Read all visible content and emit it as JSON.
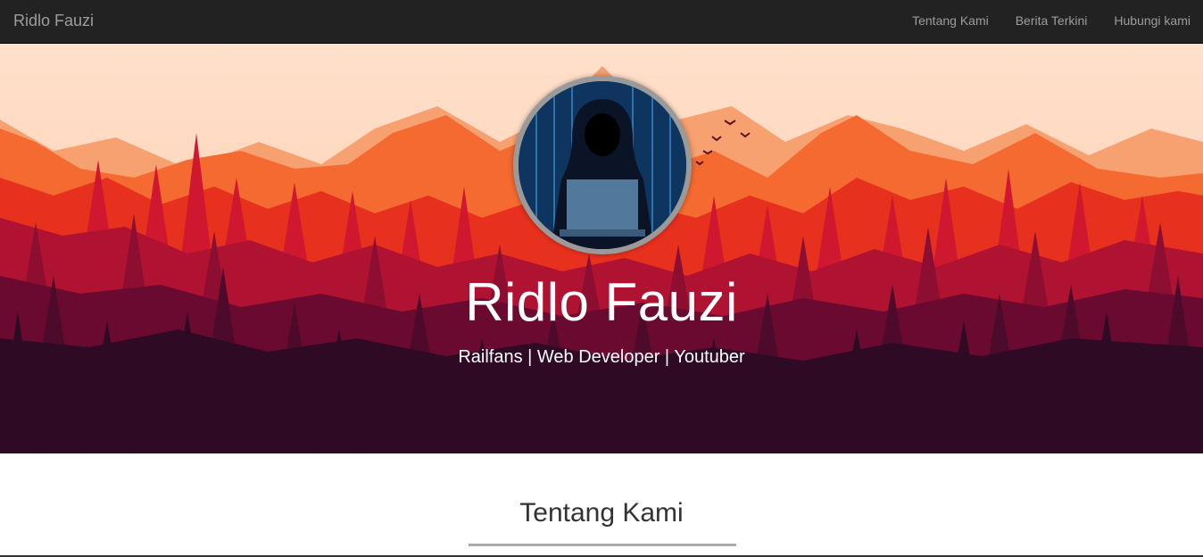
{
  "navbar": {
    "brand": "Ridlo Fauzi",
    "links": [
      {
        "label": "Tentang Kami"
      },
      {
        "label": "Berita Terkini"
      },
      {
        "label": "Hubungi kami"
      }
    ]
  },
  "hero": {
    "title": "Ridlo Fauzi",
    "subtitle": "Railfans | Web Developer | Youtuber",
    "avatar_icon": "hooded-hacker-avatar"
  },
  "section": {
    "title": "Tentang Kami"
  },
  "colors": {
    "navbar_bg": "#222222",
    "nav_text": "#9d9d9d",
    "sky": "#ffdcc8",
    "dark_forest": "#2e0a24"
  }
}
